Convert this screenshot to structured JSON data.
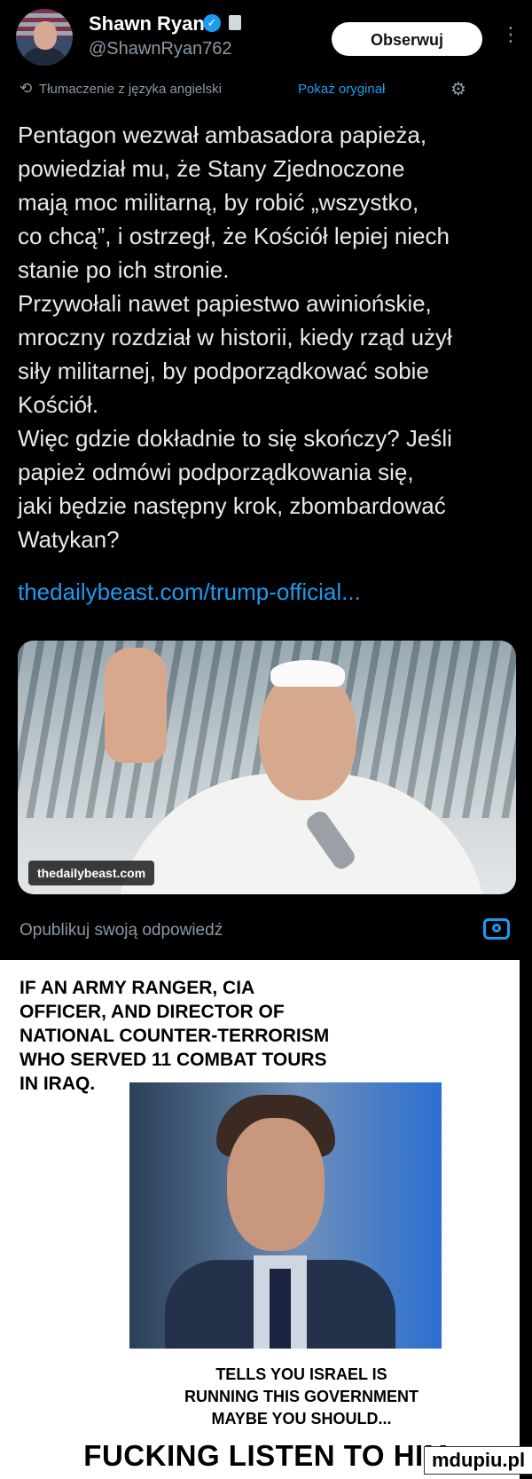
{
  "header": {
    "name": "Shawn Ryan",
    "verified_glyph": "✓",
    "handle": "@ShawnRyan762",
    "follow_label": "Obserwuj",
    "more_glyph": "⋮"
  },
  "translation": {
    "icon": "translate-icon",
    "text": "Tłumaczenie z języka angielski",
    "show_original": "Pokaż oryginał",
    "gear_glyph": "⚙"
  },
  "tweet": {
    "text": "Pentagon wezwał ambasadora papieża,\npowiedział mu, że Stany Zjednoczone\nmają moc militarną, by robić „wszystko,\nco chcą”, i ostrzegł, że Kościół lepiej niech\nstanie po ich stronie.\nPrzywołali nawet papiestwo awiniońskie,\nmroczny rozdział w historii, kiedy rząd użył\nsiły militarnej, by podporządkować sobie\nKościół.\nWięc gdzie dokładnie to się skończy? Jeśli\npapież odmówi podporządkowania się,\njaki będzie następny krok, zbombardować\nWatykan?",
    "link": "thedailybeast.com/trump-official..."
  },
  "card": {
    "badge": "thedailybeast.com"
  },
  "reply": {
    "placeholder": "Opublikuj swoją odpowiedź"
  },
  "meme": {
    "top_text": "IF AN ARMY RANGER, CIA\nOFFICER, AND DIRECTOR OF\nNATIONAL COUNTER-TERRORISM\nWHO SERVED 11 COMBAT TOURS\nIN IRAQ.",
    "bottom_text": "TELLS YOU ISRAEL IS\nRUNNING THIS GOVERNMENT\nMAYBE YOU SHOULD...",
    "punchline": "FUCKING LISTEN TO HIM"
  },
  "watermark": "mdupiu.pl",
  "colors": {
    "background": "#000000",
    "link_blue": "#1d9bf0",
    "muted": "#8b98a5"
  }
}
